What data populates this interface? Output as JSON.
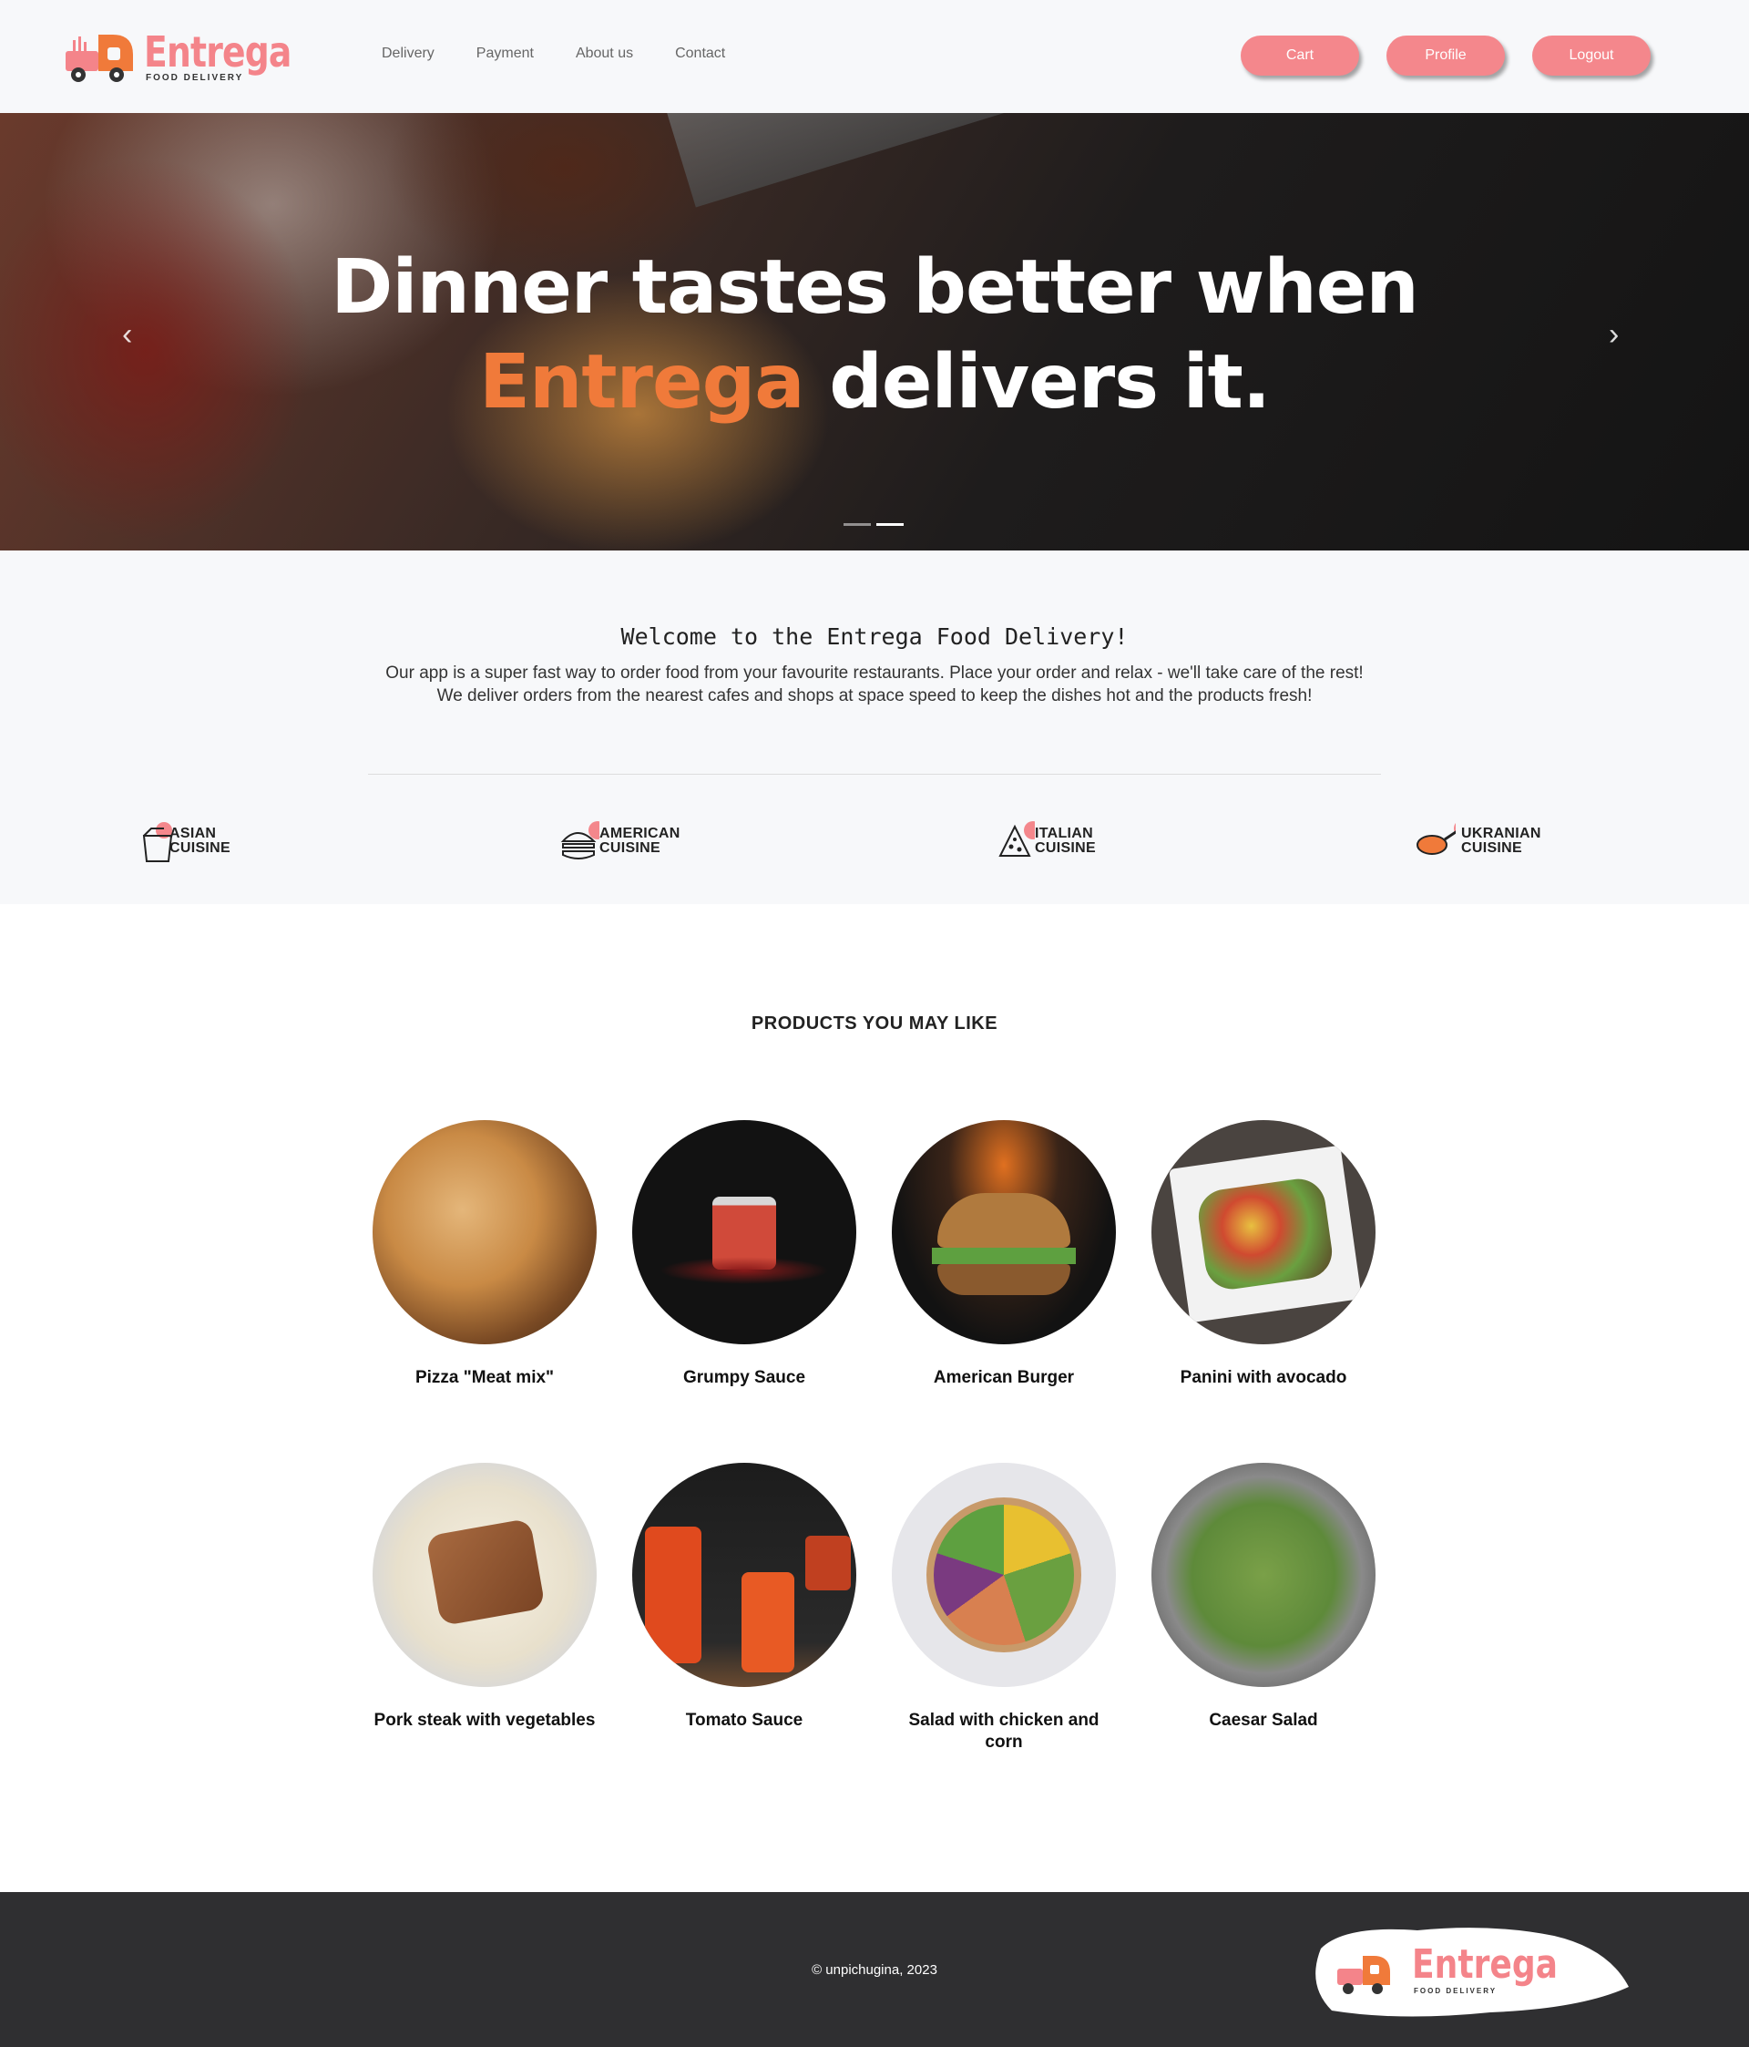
{
  "header": {
    "logo_word": "Entrega",
    "logo_sub": "FOOD DELIVERY",
    "nav": [
      "Delivery",
      "Payment",
      "About us",
      "Contact"
    ],
    "buttons": {
      "cart": "Cart",
      "profile": "Profile",
      "logout": "Logout"
    }
  },
  "hero": {
    "line1": "Dinner tastes better when",
    "accent": "Entrega",
    "line2_rest": " delivers it.",
    "prev_glyph": "‹",
    "next_glyph": "›"
  },
  "welcome": {
    "title": "Welcome to the Entrega Food Delivery!",
    "text": "Our app is a super fast way to order food from your favourite restaurants. Place your order and relax - we'll take care of the rest! We deliver orders from the nearest cafes and shops at space speed to keep the dishes hot and the products fresh!"
  },
  "cuisines": [
    {
      "line1": "ASIAN",
      "line2": "CUISINE",
      "icon": "noodle-box-icon"
    },
    {
      "line1": "AMERICAN",
      "line2": "CUISINE",
      "icon": "burger-icon"
    },
    {
      "line1": "ITALIAN",
      "line2": "CUISINE",
      "icon": "pizza-slice-icon"
    },
    {
      "line1": "UKRANIAN",
      "line2": "CUISINE",
      "icon": "frying-pan-icon"
    }
  ],
  "products_title": "PRODUCTS YOU MAY LIKE",
  "products": [
    {
      "name": "Pizza \"Meat mix\""
    },
    {
      "name": "Grumpy Sauce"
    },
    {
      "name": "American Burger"
    },
    {
      "name": "Panini with avocado"
    },
    {
      "name": "Pork steak with vegetables"
    },
    {
      "name": "Tomato Sauce"
    },
    {
      "name": "Salad with chicken and corn"
    },
    {
      "name": "Caesar Salad"
    }
  ],
  "footer": {
    "copyright": "© unpichugina, 2023"
  },
  "colors": {
    "accent_pink": "#f4878c",
    "accent_orange": "#f07a3a",
    "footer_bg": "#2f2f31",
    "header_bg": "#f7f8fa"
  }
}
